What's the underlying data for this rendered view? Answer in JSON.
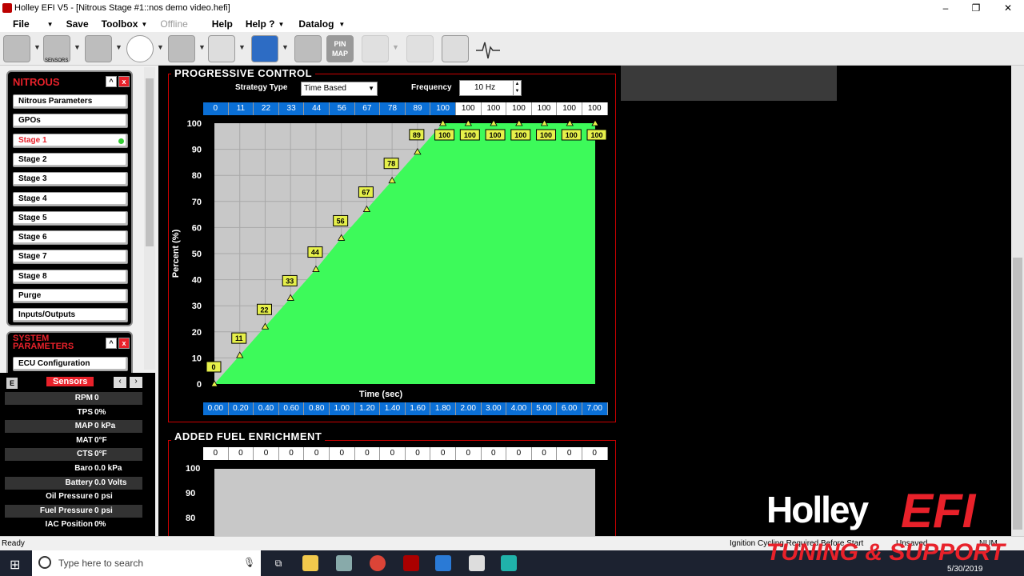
{
  "window": {
    "title": "Holley EFI V5 - [Nitrous Stage #1::nos demo video.hefi]",
    "min": "–",
    "max": "❐",
    "close": "✕"
  },
  "menu": {
    "file": "File",
    "save": "Save",
    "toolbox": "Toolbox",
    "offline": "Offline",
    "help": "Help",
    "helpq": "Help ?",
    "datalog": "Datalog"
  },
  "toolbar": {
    "sensors_label": "SENSORS",
    "pinmap_label": "PIN MAP"
  },
  "nitrous": {
    "header": "NITROUS",
    "items": [
      "Nitrous Parameters",
      "GPOs",
      "Stage 1",
      "Stage 2",
      "Stage 3",
      "Stage 4",
      "Stage 5",
      "Stage 6",
      "Stage 7",
      "Stage 8",
      "Purge",
      "Inputs/Outputs"
    ],
    "active_index": 2
  },
  "system": {
    "header_line1": "SYSTEM",
    "header_line2": "PARAMETERS",
    "items": [
      "ECU Configuration"
    ]
  },
  "sensors": {
    "e_label": "E",
    "title": "Sensors",
    "rows": [
      {
        "label": "RPM",
        "value": "0"
      },
      {
        "label": "TPS",
        "value": "0%"
      },
      {
        "label": "MAP",
        "value": "0 kPa"
      },
      {
        "label": "MAT",
        "value": "0°F"
      },
      {
        "label": "CTS",
        "value": "0°F"
      },
      {
        "label": "Baro",
        "value": "0.0 kPa"
      },
      {
        "label": "Battery",
        "value": "0.0 Volts"
      },
      {
        "label": "Oil Pressure",
        "value": "0 psi"
      },
      {
        "label": "Fuel Pressure",
        "value": "0 psi"
      },
      {
        "label": "IAC Position",
        "value": "0%"
      }
    ]
  },
  "progressive": {
    "title": "PROGRESSIVE CONTROL",
    "strategy_label": "Strategy Type",
    "strategy_value": "Time Based",
    "frequency_label": "Frequency",
    "frequency_value": "10 Hz"
  },
  "chart_data": {
    "type": "area",
    "xlabel": "Time (sec)",
    "ylabel": "Percent (%)",
    "ylim": [
      0,
      100
    ],
    "yticks": [
      0,
      10,
      20,
      30,
      40,
      50,
      60,
      70,
      80,
      90,
      100
    ],
    "x": [
      "0.00",
      "0.20",
      "0.40",
      "0.60",
      "0.80",
      "1.00",
      "1.20",
      "1.40",
      "1.60",
      "1.80",
      "2.00",
      "3.00",
      "4.00",
      "5.00",
      "6.00",
      "7.00"
    ],
    "values": [
      0,
      11,
      22,
      33,
      44,
      56,
      67,
      78,
      89,
      100,
      100,
      100,
      100,
      100,
      100,
      100
    ],
    "fill_color": "#3dfa5a",
    "grid": true
  },
  "fuel": {
    "title": "ADDED FUEL ENRICHMENT",
    "values": [
      0,
      0,
      0,
      0,
      0,
      0,
      0,
      0,
      0,
      0,
      0,
      0,
      0,
      0,
      0,
      0
    ],
    "yticks": [
      "100",
      "90",
      "80"
    ]
  },
  "status": {
    "ready": "Ready",
    "ignition": "Ignition Cycling Required Before Start",
    "saved": "Unsaved",
    "num": "NUM"
  },
  "taskbar": {
    "search_placeholder": "Type here to search",
    "date": "5/30/2019"
  },
  "logo": {
    "line1": "Holley",
    "line2": "EFI",
    "line3": "TUNING & SUPPORT"
  },
  "colors": {
    "accent_red": "#e8212a",
    "cell_blue": "#0a6fd6",
    "label_yellow": "#e6f04a"
  }
}
